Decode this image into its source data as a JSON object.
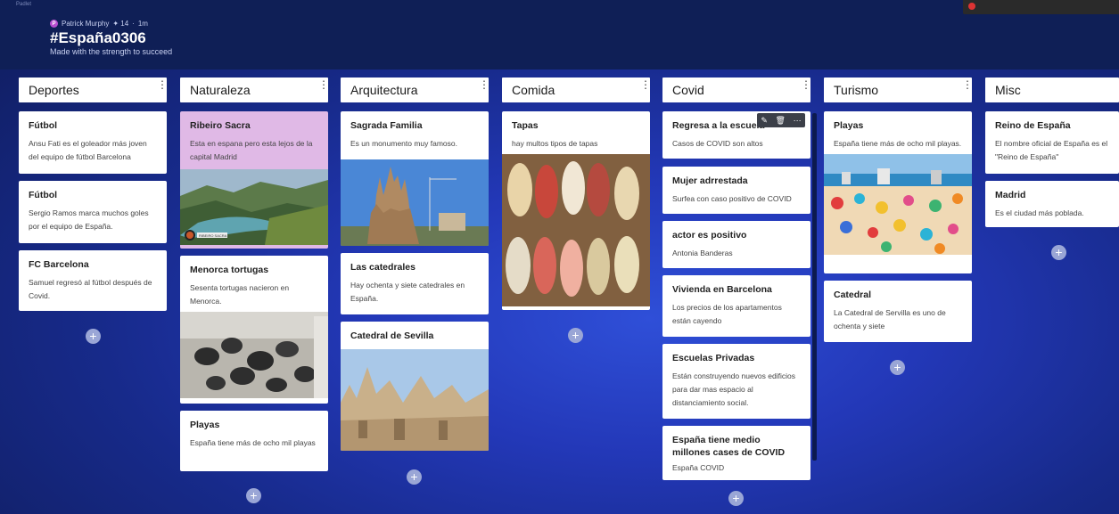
{
  "header": {
    "corner_text": "Padlet",
    "author_initial": "P",
    "author": "Patrick Murphy",
    "likes": "✦ 14",
    "time": "1m",
    "title": "#España0306",
    "subtitle": "Made with the strength to succeed"
  },
  "columns": [
    {
      "title": "Deportes",
      "cards": [
        {
          "title": "Fútbol",
          "body": "Ansu Fati es el goleador más joven del equipo de fútbol Barcelona"
        },
        {
          "title": "Fútbol",
          "body": "Sergio Ramos marca muchos goles por el equipo de España."
        },
        {
          "title": "FC Barcelona",
          "body": "Samuel regresó al fútbol después de Covid."
        }
      ]
    },
    {
      "title": "Naturaleza",
      "cards": [
        {
          "title": "Ribeiro Sacra",
          "body": "Esta en espana pero esta lejos de la capital Madrid"
        },
        {
          "title": "Menorca tortugas",
          "body": "Sesenta tortugas nacieron en Menorca."
        },
        {
          "title": "Playas",
          "body": "España tiene más de ocho mil playas"
        }
      ]
    },
    {
      "title": "Arquitectura",
      "cards": [
        {
          "title": "Sagrada Familia",
          "body": "Es un monumento muy famoso."
        },
        {
          "title": "Las catedrales",
          "body": "Hay ochenta y siete catedrales en España."
        },
        {
          "title": "Catedral de Sevilla",
          "body": ""
        }
      ]
    },
    {
      "title": "Comida",
      "cards": [
        {
          "title": "Tapas",
          "body": "hay multos tipos de tapas"
        }
      ]
    },
    {
      "title": "Covid",
      "cards": [
        {
          "title": "Regresa a la escuela",
          "body": "Casos de COVID son altos"
        },
        {
          "title": "Mujer adrrestada",
          "body": "Surfea con caso positivo de COVID"
        },
        {
          "title": "actor es positivo",
          "body": "Antonia Banderas"
        },
        {
          "title": "Vivienda en Barcelona",
          "body": "Los precios de los apartamentos están cayendo"
        },
        {
          "title": "Escuelas Privadas",
          "body": "Están construyendo nuevos edificios para dar mas espacio al distanciamiento social."
        },
        {
          "title": "España tiene medio millones cases de COVID",
          "body": "España COVID"
        }
      ]
    },
    {
      "title": "Turismo",
      "cards": [
        {
          "title": "Playas",
          "body": "España tiene más de ocho mil playas."
        },
        {
          "title": "Catedral",
          "body": "La Catedral de Servilla es uno de ochenta y siete"
        }
      ]
    },
    {
      "title": "Misc",
      "cards": [
        {
          "title": "Reino de España",
          "body": "El nombre oficial de España es el \"Reino de España\""
        },
        {
          "title": "Madrid",
          "body": "Es el ciudad más poblada."
        }
      ]
    }
  ],
  "ui": {
    "menu_glyph": "⋮",
    "add_glyph": "+",
    "edit_icon": "✎",
    "delete_icon": "🗑",
    "more_icon": "⋯",
    "image_caption": "RIBEIRO SACRA"
  }
}
